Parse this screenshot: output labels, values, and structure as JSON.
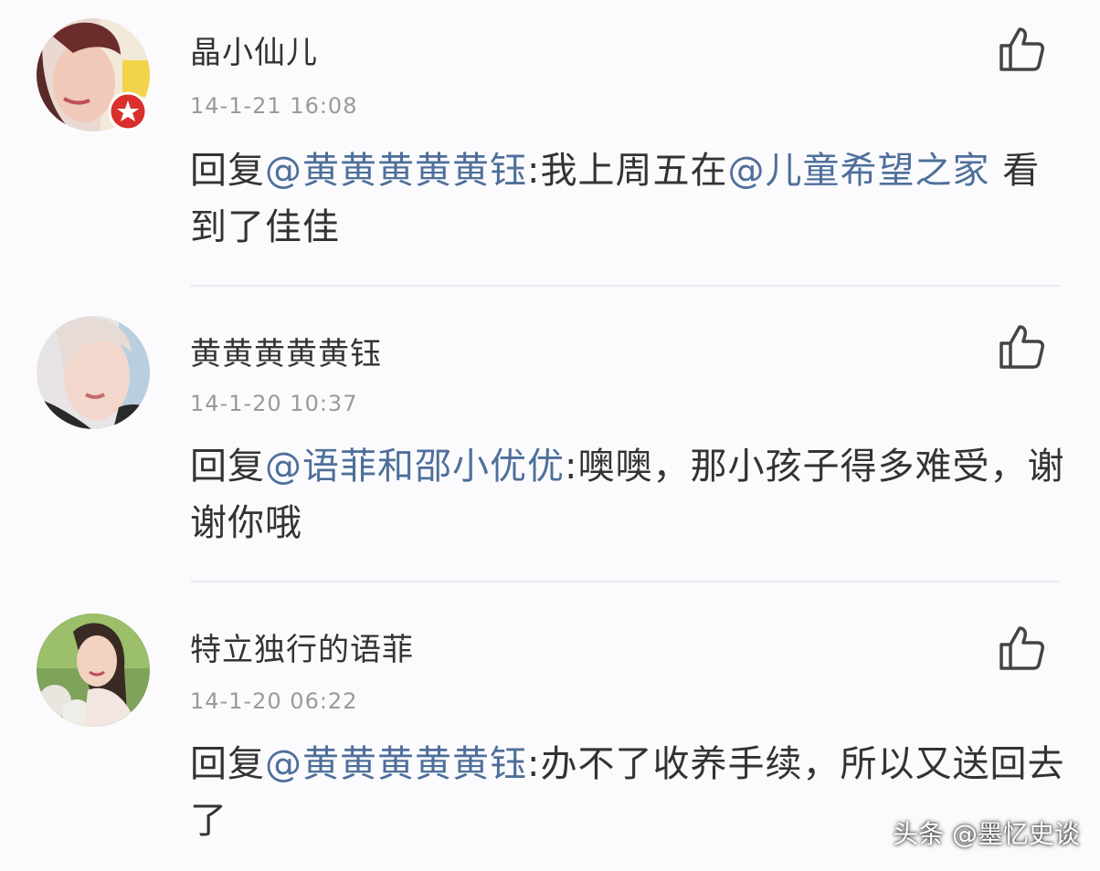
{
  "comments": [
    {
      "username": "晶小仙儿",
      "time": "14-1-21 16:08",
      "reply_prefix": "回复",
      "mention": "@黄黄黄黄黄钰",
      "text_a": ":我上周五在",
      "mention2": "@儿童希望之家",
      "text_b": " 看到了佳佳"
    },
    {
      "username": "黄黄黄黄黄钰",
      "time": "14-1-20 10:37",
      "reply_prefix": "回复",
      "mention": "@语菲和邵小优优",
      "text_a": ":噢噢，那小孩子得多难受，谢谢你哦"
    },
    {
      "username": "特立独行的语菲",
      "time": "14-1-20 06:22",
      "reply_prefix": "回复",
      "mention": "@黄黄黄黄黄钰",
      "text_a": ":办不了收养手续，所以又送回去了"
    }
  ],
  "icons": {
    "like": "thumbs-up-icon",
    "badge": "star-badge-icon"
  },
  "colors": {
    "background": "#fbfbfd",
    "text": "#333333",
    "mention": "#4f6f9a",
    "timestamp": "#9a9a9a",
    "badge": "#d9302c"
  },
  "watermark": "头条 @墨忆史谈"
}
